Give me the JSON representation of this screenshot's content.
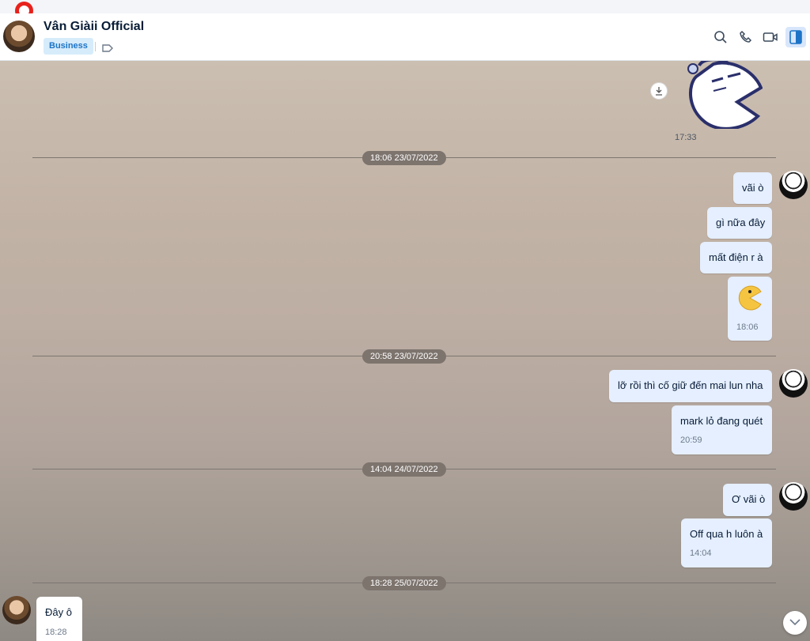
{
  "header": {
    "contact_name": "Vân Giàii Official",
    "badge": "Business",
    "icons": [
      "search-icon",
      "phone-icon",
      "video-icon",
      "sidebar-toggle-icon"
    ]
  },
  "conversation": {
    "sticker_time": "17:33",
    "sections": [
      {
        "date": "18:06 23/07/2022",
        "messages": [
          {
            "text": "vãi ò"
          },
          {
            "text": "gì nữa đây"
          },
          {
            "text": "mất điện r à"
          },
          {
            "emoji": "pacman-emoji",
            "time": "18:06"
          }
        ]
      },
      {
        "date": "20:58 23/07/2022",
        "messages": [
          {
            "text": "lỡ rồi thì cố giữ đến mai lun nha"
          },
          {
            "text": "mark lỏ đang quét",
            "time": "20:59"
          }
        ]
      },
      {
        "date": "14:04 24/07/2022",
        "messages": [
          {
            "text": "Ơ vãi ò"
          },
          {
            "text": "Off qua h luôn à",
            "time": "14:04"
          }
        ]
      },
      {
        "date": "18:28 25/07/2022",
        "messages": [
          {
            "text": "Đây ô",
            "time": "18:28",
            "incoming": true
          }
        ]
      }
    ]
  },
  "colors": {
    "accent": "#1d74c7",
    "outgoing_bubble": "#e5efff",
    "incoming_bubble": "#ffffff",
    "record_indicator": "#e8211b"
  }
}
